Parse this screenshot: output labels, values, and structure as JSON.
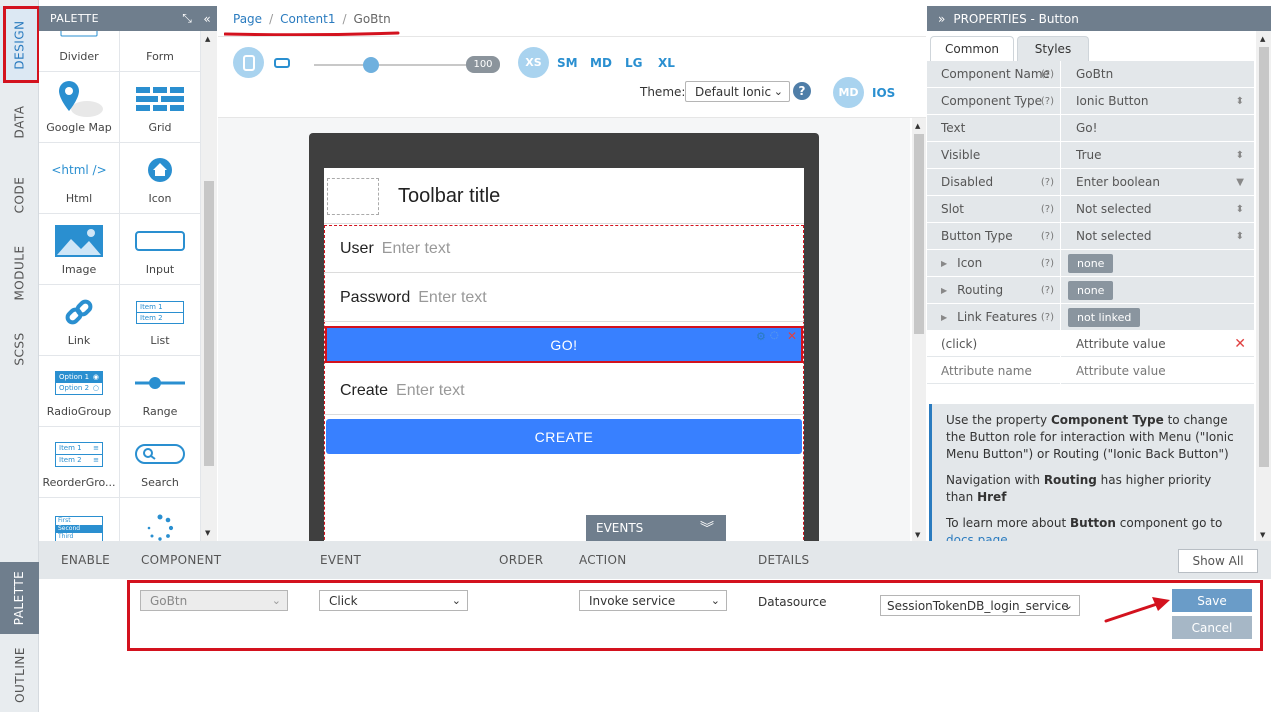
{
  "left_tabs": [
    "DESIGN",
    "DATA",
    "CODE",
    "MODULE",
    "SCSS"
  ],
  "bottom_tabs": [
    "PALETTE",
    "OUTLINE"
  ],
  "palette": {
    "title": "PALETTE",
    "items": [
      {
        "label": "Divider",
        "icon": "divider-icon"
      },
      {
        "label": "Form",
        "icon": "form-icon"
      },
      {
        "label": "Google Map",
        "icon": "map-pin-icon"
      },
      {
        "label": "Grid",
        "icon": "grid-icon"
      },
      {
        "label": "Html",
        "icon": "html-icon",
        "glyph": "<html />"
      },
      {
        "label": "Icon",
        "icon": "home-icon"
      },
      {
        "label": "Image",
        "icon": "image-icon"
      },
      {
        "label": "Input",
        "icon": "input-icon"
      },
      {
        "label": "Link",
        "icon": "link-icon"
      },
      {
        "label": "List",
        "icon": "list-icon",
        "lines": [
          "Item 1",
          "Item 2"
        ]
      },
      {
        "label": "RadioGroup",
        "icon": "radio-group-icon",
        "lines": [
          "Option 1",
          "Option 2"
        ]
      },
      {
        "label": "Range",
        "icon": "range-icon"
      },
      {
        "label": "ReorderGro...",
        "icon": "reorder-icon",
        "lines": [
          "Item 1",
          "Item 2"
        ]
      },
      {
        "label": "Search",
        "icon": "search-icon"
      },
      {
        "label": "",
        "icon": "select-list-icon",
        "lines": [
          "First",
          "Second",
          "Third"
        ]
      },
      {
        "label": "",
        "icon": "spinner-icon"
      }
    ]
  },
  "breadcrumb": [
    "Page",
    "Content1",
    "GoBtn"
  ],
  "view": {
    "zoom": "100",
    "sizes": [
      "XS",
      "SM",
      "MD",
      "LG",
      "XL"
    ],
    "theme_label": "Theme:",
    "theme_value": "Default Ionic",
    "help": "?",
    "modes": [
      "MD",
      "IOS"
    ]
  },
  "device": {
    "toolbar_title": "Toolbar title",
    "rows": [
      {
        "label": "User",
        "placeholder": "Enter text"
      },
      {
        "label": "Password",
        "placeholder": "Enter text"
      }
    ],
    "go_button": "GO!",
    "create_row": {
      "label": "Create",
      "placeholder": "Enter text"
    },
    "create_button": "CREATE"
  },
  "events_tab": "EVENTS",
  "properties": {
    "title": "PROPERTIES - Button",
    "tabs": [
      "Common",
      "Styles"
    ],
    "rows": [
      {
        "key": "Component Name",
        "help": "(?)",
        "value": "GoBtn"
      },
      {
        "key": "Component Type",
        "help": "(?)",
        "value": "Ionic Button",
        "control": "spin"
      },
      {
        "key": "Text",
        "help": "",
        "value": "Go!"
      },
      {
        "key": "Visible",
        "help": "",
        "value": "True",
        "control": "spin"
      },
      {
        "key": "Disabled",
        "help": "(?)",
        "value": "Enter boolean",
        "control": "drop"
      },
      {
        "key": "Slot",
        "help": "(?)",
        "value": "Not selected",
        "control": "spin"
      },
      {
        "key": "Button Type",
        "help": "(?)",
        "value": "Not selected",
        "control": "spin"
      },
      {
        "key": "Icon",
        "help": "(?)",
        "pill": "none",
        "expand": true
      },
      {
        "key": "Routing",
        "help": "(?)",
        "pill": "none",
        "expand": true
      },
      {
        "key": "Link Features",
        "help": "(?)",
        "pill": "not linked",
        "expand": true
      },
      {
        "key": "(click)",
        "help": "",
        "value": "Attribute value",
        "delete": true
      },
      {
        "key": "Attribute name",
        "help": "",
        "value": "Attribute value"
      }
    ],
    "info": [
      "Use the property **Component Type** to change the Button role for interaction with Menu (\"Ionic Menu Button\") or Routing (\"Ionic Back Button\")",
      "Navigation with **Routing** has higher priority than **Href**",
      "To learn more about **Button** component go to docs page."
    ]
  },
  "events_table": {
    "headers": [
      "ENABLE",
      "COMPONENT",
      "EVENT",
      "ORDER",
      "ACTION",
      "DETAILS"
    ],
    "show_all": "Show All",
    "row": {
      "component": "GoBtn",
      "event": "Click",
      "action": "Invoke service",
      "details_label": "Datasource",
      "datasource": "SessionTokenDB_login_service"
    },
    "save": "Save",
    "cancel": "Cancel"
  },
  "colors": {
    "accent": "#2a7bbf",
    "ionic_primary": "#3880ff",
    "annotation_red": "#d3121e",
    "panel_header": "#6f7e8d"
  }
}
